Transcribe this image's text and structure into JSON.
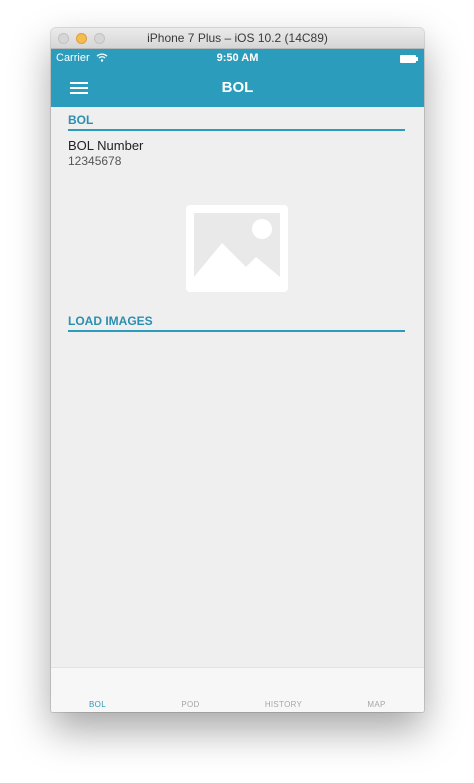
{
  "window": {
    "title": "iPhone 7 Plus – iOS 10.2 (14C89)"
  },
  "status_bar": {
    "carrier": "Carrier",
    "time": "9:50 AM",
    "wifi_icon": "wifi-icon",
    "battery_icon": "battery-icon"
  },
  "nav_bar": {
    "title": "BOL",
    "menu_icon": "hamburger-menu-icon"
  },
  "sections": {
    "bol": {
      "header": "BOL",
      "field_label": "BOL Number",
      "field_value": "12345678",
      "image_icon": "image-placeholder-icon"
    },
    "load_images": {
      "header": "LOAD IMAGES"
    }
  },
  "tabs": [
    {
      "label": "BOL",
      "active": true
    },
    {
      "label": "POD",
      "active": false
    },
    {
      "label": "HISTORY",
      "active": false
    },
    {
      "label": "MAP",
      "active": false
    }
  ],
  "colors": {
    "accent": "#2c9cbc",
    "background": "#efefef",
    "tab_inactive": "#a7a7a7"
  }
}
